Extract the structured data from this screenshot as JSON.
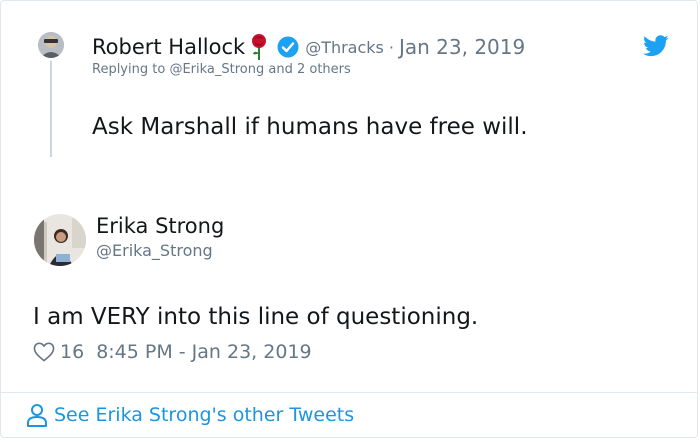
{
  "parent_tweet": {
    "author_name": "Robert Hallock",
    "handle": "@Thracks",
    "separator": "·",
    "date": "Jan 23, 2019",
    "replying_prefix": "Replying to ",
    "replying_mention": "@Erika_Strong",
    "replying_suffix": " and 2 others",
    "text": "Ask Marshall if humans have free will."
  },
  "main_tweet": {
    "author_name": "Erika Strong",
    "handle": "@Erika_Strong",
    "text": "I am VERY into this line of questioning.",
    "like_count": "16",
    "timestamp": "8:45 PM - Jan 23, 2019"
  },
  "footer": {
    "link_label": "See Erika Strong's other Tweets"
  },
  "colors": {
    "brand_blue": "#1da1f2",
    "link_blue": "#1b95e0",
    "muted_text": "#657786",
    "primary_text": "#14171a",
    "rose_red": "#c8102e"
  },
  "icons": [
    "rose-icon",
    "verified-icon",
    "twitter-logo-icon",
    "heart-icon",
    "person-icon"
  ]
}
